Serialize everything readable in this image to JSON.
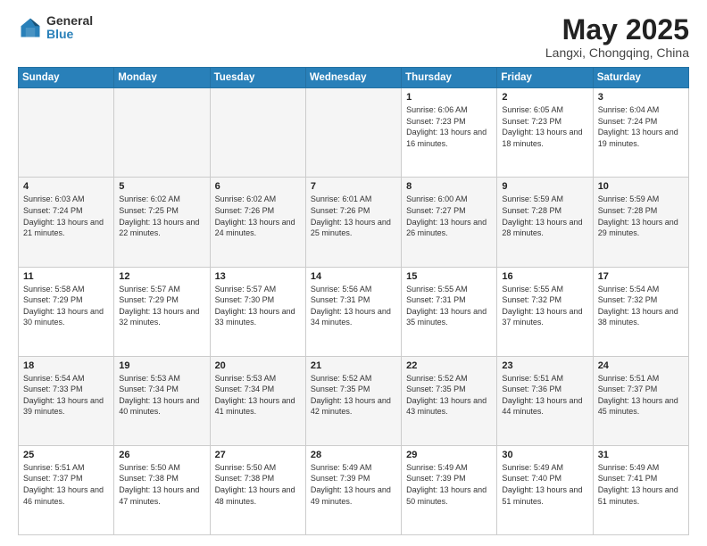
{
  "header": {
    "logo_general": "General",
    "logo_blue": "Blue",
    "month_title": "May 2025",
    "location": "Langxi, Chongqing, China"
  },
  "days_of_week": [
    "Sunday",
    "Monday",
    "Tuesday",
    "Wednesday",
    "Thursday",
    "Friday",
    "Saturday"
  ],
  "weeks": [
    [
      {
        "day": "",
        "info": ""
      },
      {
        "day": "",
        "info": ""
      },
      {
        "day": "",
        "info": ""
      },
      {
        "day": "",
        "info": ""
      },
      {
        "day": "1",
        "info": "Sunrise: 6:06 AM\nSunset: 7:23 PM\nDaylight: 13 hours and 16 minutes."
      },
      {
        "day": "2",
        "info": "Sunrise: 6:05 AM\nSunset: 7:23 PM\nDaylight: 13 hours and 18 minutes."
      },
      {
        "day": "3",
        "info": "Sunrise: 6:04 AM\nSunset: 7:24 PM\nDaylight: 13 hours and 19 minutes."
      }
    ],
    [
      {
        "day": "4",
        "info": "Sunrise: 6:03 AM\nSunset: 7:24 PM\nDaylight: 13 hours and 21 minutes."
      },
      {
        "day": "5",
        "info": "Sunrise: 6:02 AM\nSunset: 7:25 PM\nDaylight: 13 hours and 22 minutes."
      },
      {
        "day": "6",
        "info": "Sunrise: 6:02 AM\nSunset: 7:26 PM\nDaylight: 13 hours and 24 minutes."
      },
      {
        "day": "7",
        "info": "Sunrise: 6:01 AM\nSunset: 7:26 PM\nDaylight: 13 hours and 25 minutes."
      },
      {
        "day": "8",
        "info": "Sunrise: 6:00 AM\nSunset: 7:27 PM\nDaylight: 13 hours and 26 minutes."
      },
      {
        "day": "9",
        "info": "Sunrise: 5:59 AM\nSunset: 7:28 PM\nDaylight: 13 hours and 28 minutes."
      },
      {
        "day": "10",
        "info": "Sunrise: 5:59 AM\nSunset: 7:28 PM\nDaylight: 13 hours and 29 minutes."
      }
    ],
    [
      {
        "day": "11",
        "info": "Sunrise: 5:58 AM\nSunset: 7:29 PM\nDaylight: 13 hours and 30 minutes."
      },
      {
        "day": "12",
        "info": "Sunrise: 5:57 AM\nSunset: 7:29 PM\nDaylight: 13 hours and 32 minutes."
      },
      {
        "day": "13",
        "info": "Sunrise: 5:57 AM\nSunset: 7:30 PM\nDaylight: 13 hours and 33 minutes."
      },
      {
        "day": "14",
        "info": "Sunrise: 5:56 AM\nSunset: 7:31 PM\nDaylight: 13 hours and 34 minutes."
      },
      {
        "day": "15",
        "info": "Sunrise: 5:55 AM\nSunset: 7:31 PM\nDaylight: 13 hours and 35 minutes."
      },
      {
        "day": "16",
        "info": "Sunrise: 5:55 AM\nSunset: 7:32 PM\nDaylight: 13 hours and 37 minutes."
      },
      {
        "day": "17",
        "info": "Sunrise: 5:54 AM\nSunset: 7:32 PM\nDaylight: 13 hours and 38 minutes."
      }
    ],
    [
      {
        "day": "18",
        "info": "Sunrise: 5:54 AM\nSunset: 7:33 PM\nDaylight: 13 hours and 39 minutes."
      },
      {
        "day": "19",
        "info": "Sunrise: 5:53 AM\nSunset: 7:34 PM\nDaylight: 13 hours and 40 minutes."
      },
      {
        "day": "20",
        "info": "Sunrise: 5:53 AM\nSunset: 7:34 PM\nDaylight: 13 hours and 41 minutes."
      },
      {
        "day": "21",
        "info": "Sunrise: 5:52 AM\nSunset: 7:35 PM\nDaylight: 13 hours and 42 minutes."
      },
      {
        "day": "22",
        "info": "Sunrise: 5:52 AM\nSunset: 7:35 PM\nDaylight: 13 hours and 43 minutes."
      },
      {
        "day": "23",
        "info": "Sunrise: 5:51 AM\nSunset: 7:36 PM\nDaylight: 13 hours and 44 minutes."
      },
      {
        "day": "24",
        "info": "Sunrise: 5:51 AM\nSunset: 7:37 PM\nDaylight: 13 hours and 45 minutes."
      }
    ],
    [
      {
        "day": "25",
        "info": "Sunrise: 5:51 AM\nSunset: 7:37 PM\nDaylight: 13 hours and 46 minutes."
      },
      {
        "day": "26",
        "info": "Sunrise: 5:50 AM\nSunset: 7:38 PM\nDaylight: 13 hours and 47 minutes."
      },
      {
        "day": "27",
        "info": "Sunrise: 5:50 AM\nSunset: 7:38 PM\nDaylight: 13 hours and 48 minutes."
      },
      {
        "day": "28",
        "info": "Sunrise: 5:49 AM\nSunset: 7:39 PM\nDaylight: 13 hours and 49 minutes."
      },
      {
        "day": "29",
        "info": "Sunrise: 5:49 AM\nSunset: 7:39 PM\nDaylight: 13 hours and 50 minutes."
      },
      {
        "day": "30",
        "info": "Sunrise: 5:49 AM\nSunset: 7:40 PM\nDaylight: 13 hours and 51 minutes."
      },
      {
        "day": "31",
        "info": "Sunrise: 5:49 AM\nSunset: 7:41 PM\nDaylight: 13 hours and 51 minutes."
      }
    ]
  ]
}
